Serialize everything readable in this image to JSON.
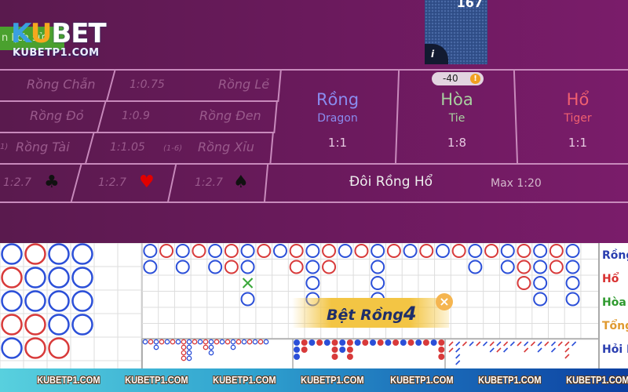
{
  "logo": {
    "brand_k": "K",
    "brand_u": "U",
    "brand_bet": "BET",
    "url": "KUBETP1.COM",
    "partial_button": "n lịch sử"
  },
  "card": {
    "count": "167",
    "info_icon": "i"
  },
  "side_bets": {
    "rows": [
      {
        "left": "Rồng Chẵn",
        "odds": "1:0.75",
        "right": "Rồng Lẻ"
      },
      {
        "left": "Rồng Đỏ",
        "odds": "1:0.9",
        "right": "Rồng Đen"
      },
      {
        "left": "Rồng Tài",
        "left_prefix": "1)",
        "odds": "1:1.05",
        "range": "(1-6)",
        "right": "Rồng Xỉu"
      }
    ],
    "suits": [
      {
        "odds": "1:2.7",
        "suit": "club-icon",
        "glyph": "♣",
        "color": "#111111"
      },
      {
        "odds": "1:2.7",
        "suit": "heart-icon",
        "glyph": "♥",
        "color": "#e00000"
      },
      {
        "odds": "1:2.7",
        "suit": "spade-icon",
        "glyph": "♠",
        "color": "#111111"
      }
    ]
  },
  "main_bets": [
    {
      "vn": "Rồng",
      "en": "Dragon",
      "odds": "1:1",
      "color": "#8a8cf0"
    },
    {
      "vn": "Hòa",
      "en": "Tie",
      "odds": "1:8",
      "color": "#a8d0a0"
    },
    {
      "vn": "Hổ",
      "en": "Tiger",
      "odds": "1:1",
      "color": "#f06070"
    }
  ],
  "tie_badge": {
    "value": "-40",
    "icon": "!"
  },
  "pair_bet": {
    "label": "Đôi Rồng Hổ",
    "max": "Max 1:20"
  },
  "bead_road": {
    "columns": [
      [
        "B",
        "R",
        "B",
        "R",
        "B"
      ],
      [
        "R",
        "B",
        "B",
        "R",
        "R"
      ],
      [
        "B",
        "B",
        "B",
        "B",
        "R"
      ],
      [
        "B",
        "B",
        "B",
        "B"
      ]
    ]
  },
  "big_road": {
    "columns": [
      [
        "B",
        "B"
      ],
      [
        "R"
      ],
      [
        "B",
        "B"
      ],
      [
        "R"
      ],
      [
        "B",
        "B"
      ],
      [
        "R",
        "R"
      ],
      [
        "B",
        "B",
        "T",
        "B"
      ],
      [
        "R"
      ],
      [
        "B"
      ],
      [
        "R",
        "R"
      ],
      [
        "B",
        "B",
        "B",
        "B"
      ],
      [
        "R",
        "R"
      ],
      [
        "B"
      ],
      [
        "R"
      ],
      [
        "B",
        "B",
        "B",
        "B"
      ],
      [
        "R"
      ],
      [
        "B"
      ],
      [
        "R"
      ],
      [
        "B"
      ],
      [
        "R"
      ],
      [
        "B",
        "B"
      ],
      [
        "R"
      ],
      [
        "B",
        "B"
      ],
      [
        "R",
        "R",
        "R"
      ],
      [
        "B",
        "B",
        "B",
        "B"
      ],
      [
        "R",
        "R"
      ],
      [
        "B",
        "B",
        "B",
        "B"
      ]
    ]
  },
  "popup": {
    "text": "Bệt Rồng",
    "count": "4",
    "close_icon": "×"
  },
  "stats": {
    "labels": [
      {
        "text": "Rồng",
        "color": "#2a3eb0"
      },
      {
        "text": "Hổ",
        "color": "#d83030"
      },
      {
        "text": "Hòa",
        "color": "#2e9a2e"
      },
      {
        "text": "Tổng",
        "color": "#e09a30"
      },
      {
        "text": "Hỏi R",
        "color": "#2a3eb0"
      }
    ]
  },
  "footer": {
    "watermark": "KUBETP1.COM"
  },
  "colors": {
    "banker_blue": "#2b4fd8",
    "red": "#d83a3a",
    "tie_green": "#3aa83a"
  }
}
